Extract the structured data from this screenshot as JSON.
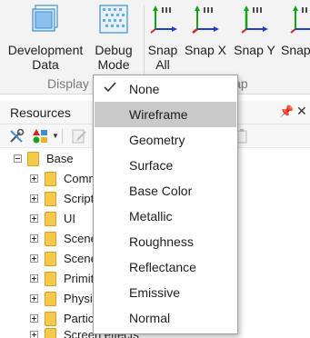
{
  "ribbon": {
    "buttons": [
      {
        "line1": "Development",
        "line2": "Data",
        "icon": "development-data-icon"
      },
      {
        "line1": "Debug",
        "line2": "Mode",
        "icon": "debug-mode-icon"
      },
      {
        "line1": "Snap",
        "line2": "All",
        "icon": "snap-all-icon"
      },
      {
        "line1": "Snap X",
        "line2": "",
        "icon": "snap-x-icon"
      },
      {
        "line1": "Snap Y",
        "line2": "",
        "icon": "snap-y-icon"
      },
      {
        "line1": "Snap",
        "line2": "",
        "icon": "snap-z-icon"
      }
    ],
    "groups": {
      "display": "Display",
      "snap": "Snap"
    }
  },
  "resources_panel": {
    "title": "Resources",
    "pin_glyph": "📌",
    "close_glyph": "✕",
    "tree": {
      "root": "Base",
      "children": [
        "Comm",
        "Script",
        "UI",
        "Scene",
        "Scene",
        "Primit",
        "Physi",
        "Partic",
        "Screen effects"
      ]
    }
  },
  "debug_menu": {
    "items": [
      "None",
      "Wireframe",
      "Geometry",
      "Surface",
      "Base Color",
      "Metallic",
      "Roughness",
      "Reflectance",
      "Emissive",
      "Normal"
    ],
    "checked": "None",
    "highlighted": "Wireframe"
  },
  "colors": {
    "ribbon_bg": "#f3f3f3",
    "menu_highlight": "#c9c9c9",
    "folder": "#f6c94a",
    "axis_x": "#e02020",
    "axis_y": "#17a317",
    "axis_z": "#1f3fd6",
    "icon_blue": "#3b8fd8"
  }
}
